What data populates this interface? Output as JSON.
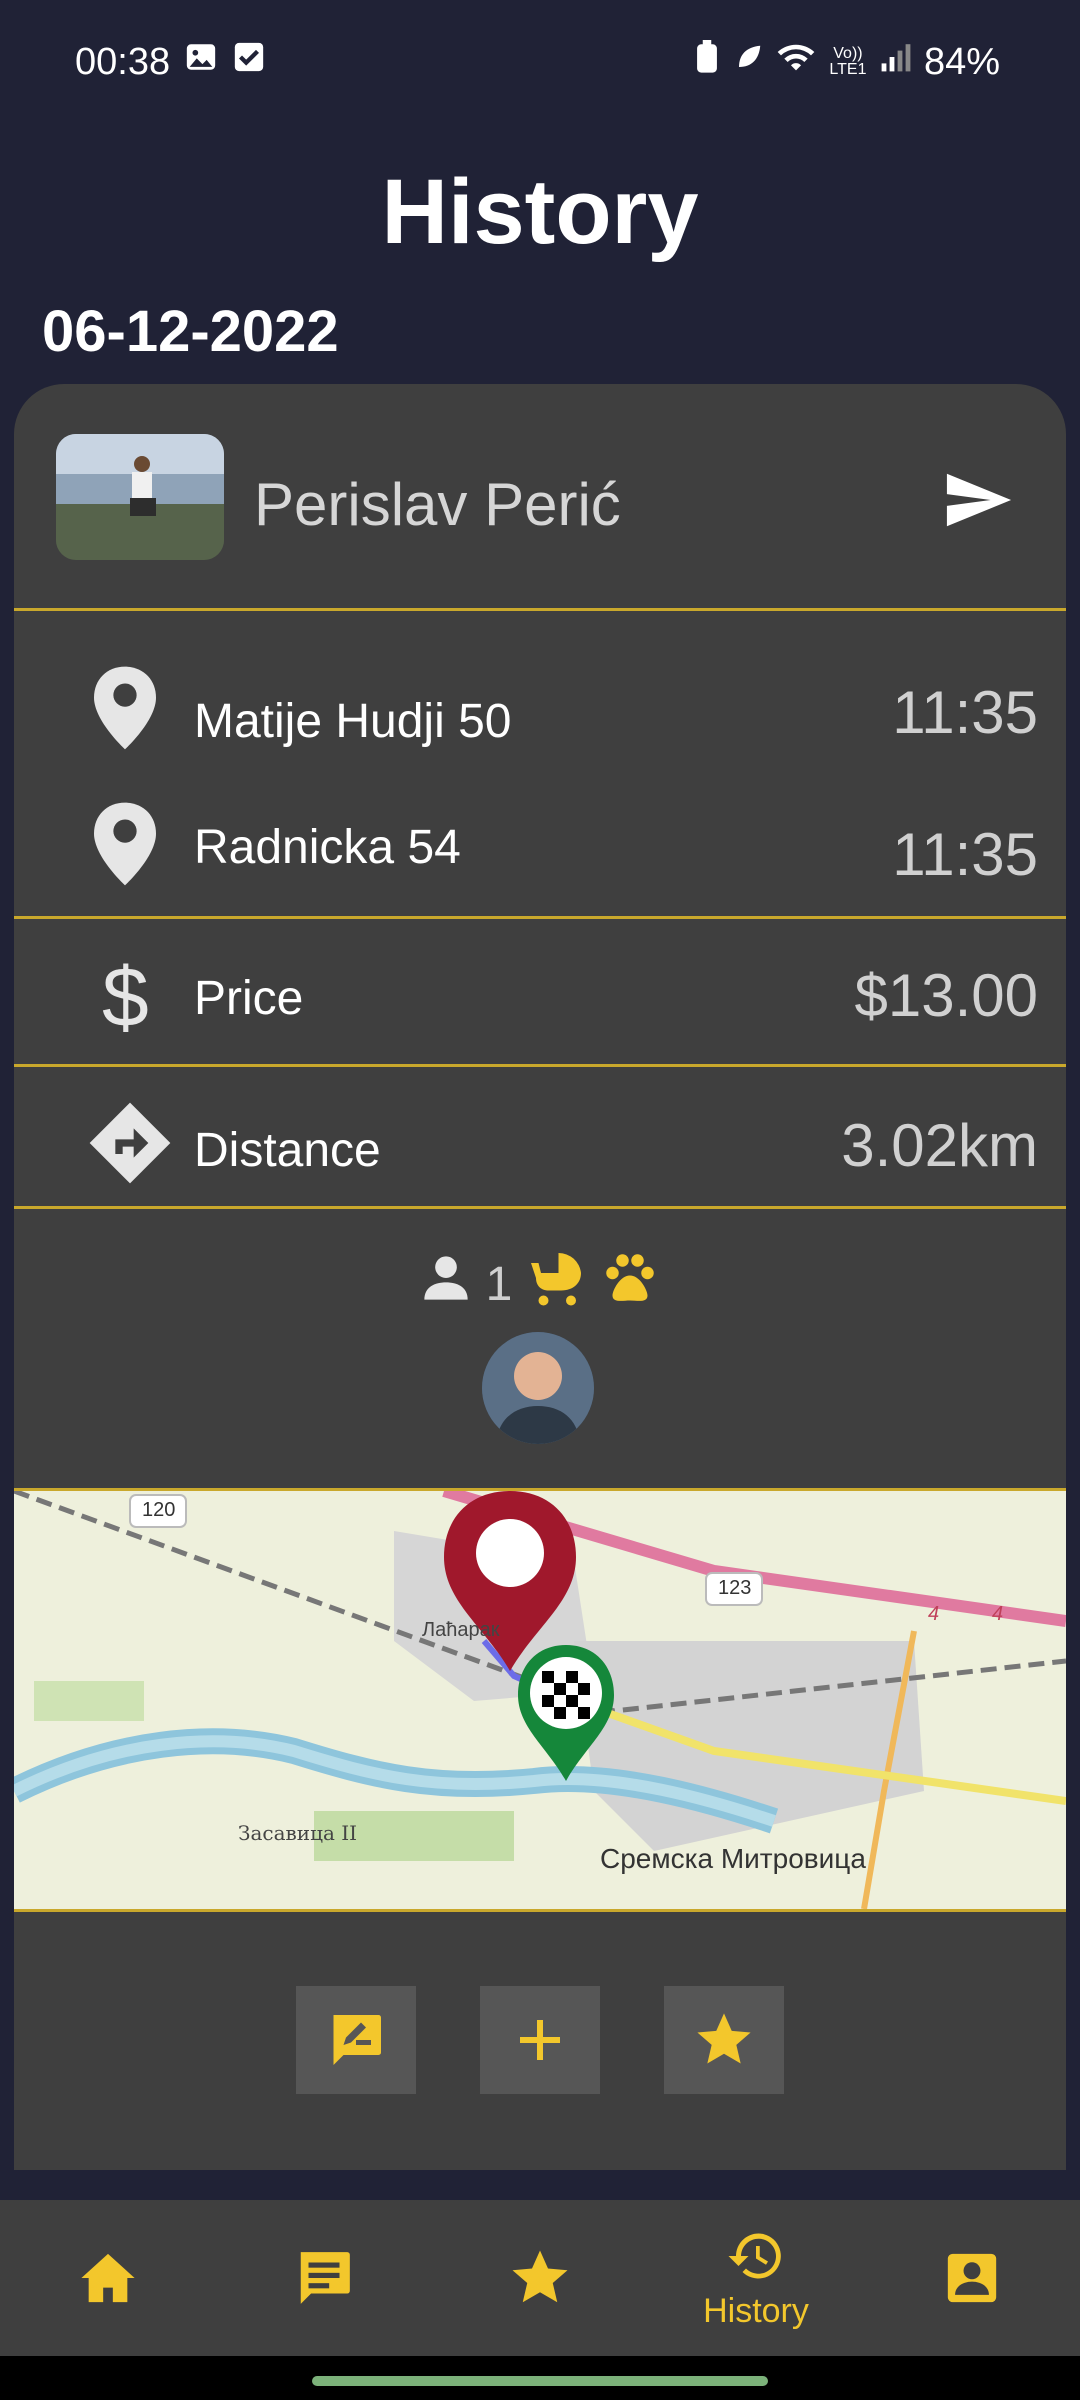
{
  "status_bar": {
    "time": "00:38",
    "battery": "84%",
    "network": "Vo)) LTE1"
  },
  "header": {
    "title": "History",
    "date": "06-12-2022"
  },
  "driver": {
    "name": "Perislav Perić"
  },
  "trip": {
    "pickup": {
      "address": "Matije Hudji 50",
      "time": "11:35"
    },
    "dropoff": {
      "address": "Radnicka 54",
      "time": "11:35"
    },
    "price": {
      "label": "Price",
      "value": "$13.00"
    },
    "distance": {
      "label": "Distance",
      "value": "3.02km"
    },
    "passengers": "1"
  },
  "map": {
    "labels": {
      "road_120": "120",
      "road_123": "123",
      "road_4a": "4",
      "road_4b": "4",
      "village": "Лаћарак",
      "zasavica": "Засавица II",
      "city": "Сремска Митровица"
    }
  },
  "bottom_nav": {
    "history_label": "History"
  },
  "colors": {
    "accent": "#f3c72c",
    "background": "#202236",
    "card": "#3f3f3f",
    "divider": "#c9a82c"
  }
}
